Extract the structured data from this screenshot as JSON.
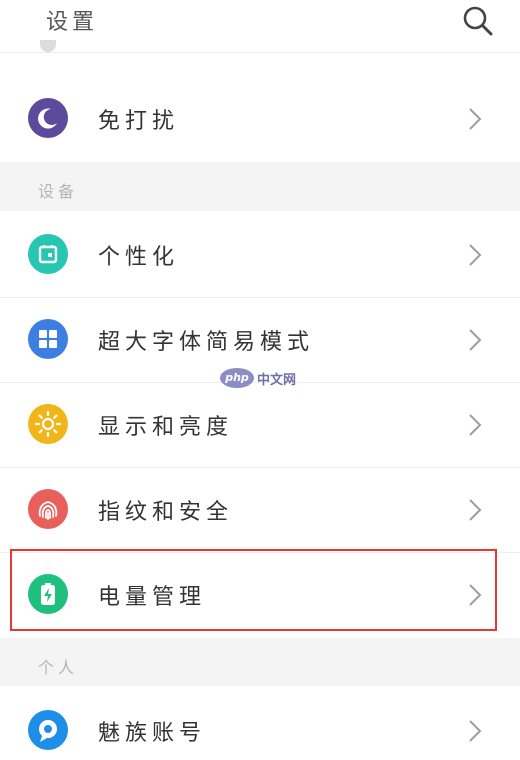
{
  "header": {
    "title": "设置",
    "search_icon": "search-icon"
  },
  "rows": {
    "dnd": {
      "label": "免打扰",
      "icon": "moon-icon",
      "color": "#5b4b9c"
    },
    "personalize": {
      "label": "个性化",
      "icon": "theme-icon",
      "color": "#26c6b0"
    },
    "large_font": {
      "label": "超大字体简易模式",
      "icon": "grid-icon",
      "color": "#3d7fe0"
    },
    "display": {
      "label": "显示和亮度",
      "icon": "sun-icon",
      "color": "#f3b418"
    },
    "fingerprint": {
      "label": "指纹和安全",
      "icon": "fingerprint-icon",
      "color": "#e95f5a"
    },
    "battery": {
      "label": "电量管理",
      "icon": "battery-icon",
      "color": "#1fbf7f"
    },
    "account": {
      "label": "魅族账号",
      "icon": "account-icon",
      "color": "#1e8ee8"
    }
  },
  "sections": {
    "device": "设备",
    "personal": "个人"
  },
  "highlight_color": "#e53935",
  "watermark": {
    "logo": "php",
    "text": "中文网"
  }
}
